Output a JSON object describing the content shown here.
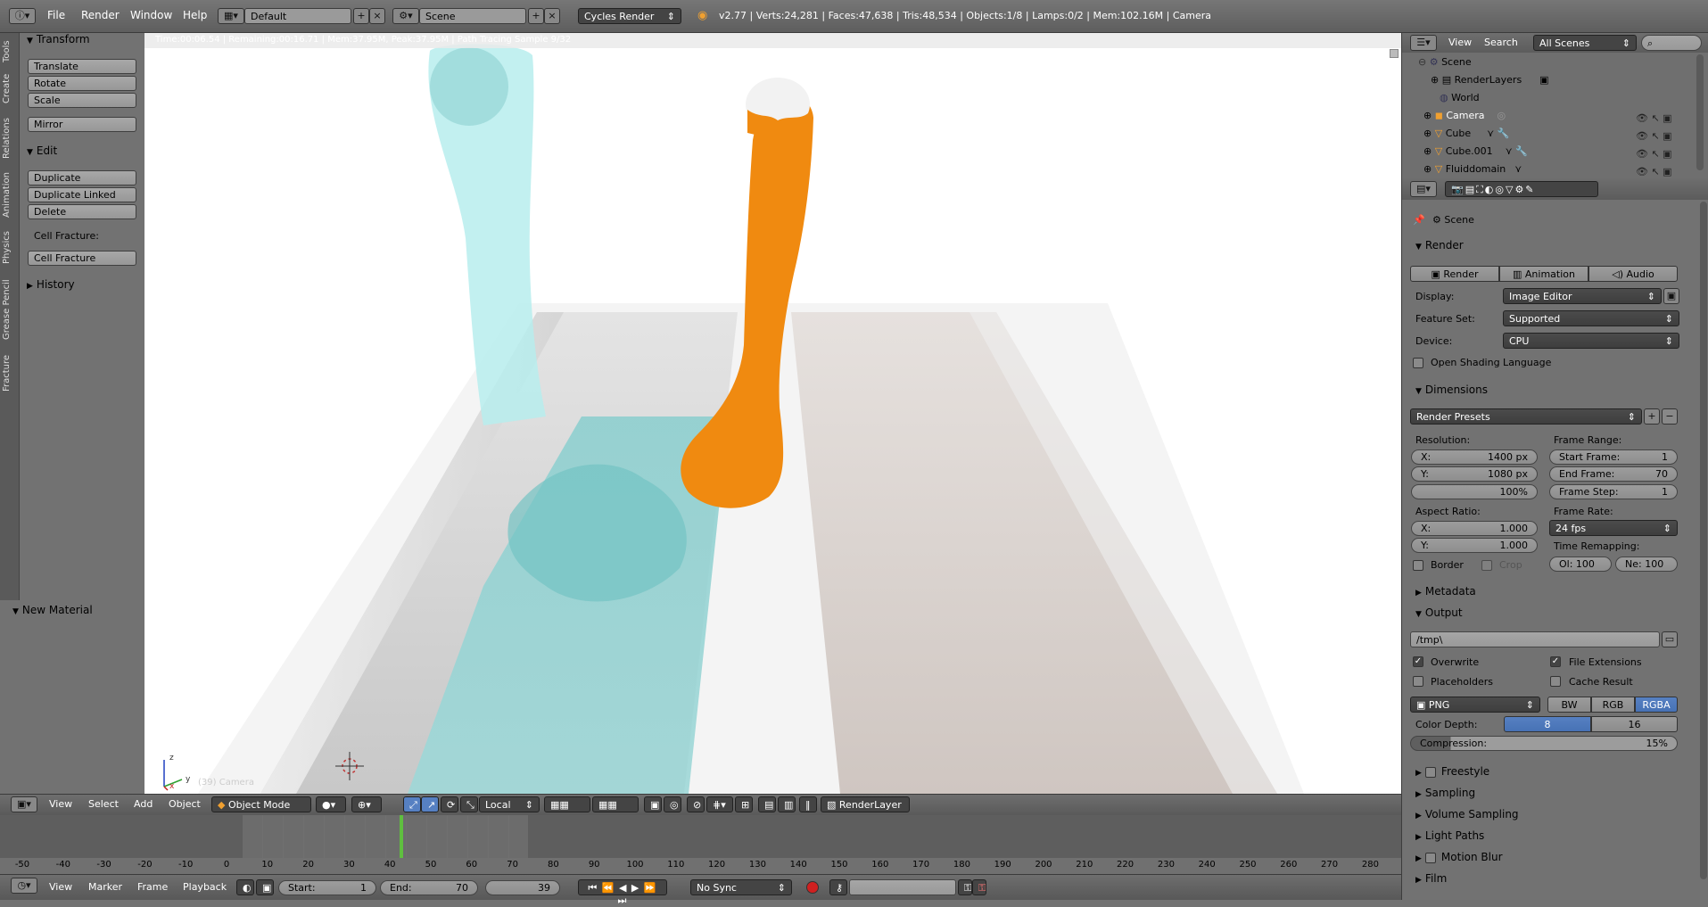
{
  "topbar": {
    "menus": [
      "File",
      "Render",
      "Window",
      "Help"
    ],
    "layout": "Default",
    "scene": "Scene",
    "engine": "Cycles Render",
    "stats": "v2.77 | Verts:24,281 | Faces:47,638 | Tris:48,534 | Objects:1/8 | Lamps:0/2 | Mem:102.16M | Camera"
  },
  "tool_tabs": [
    "Tools",
    "Create",
    "Relations",
    "Animation",
    "Physics",
    "Grease Pencil",
    "Fracture"
  ],
  "tools": {
    "transform_title": "Transform",
    "translate": "Translate",
    "rotate": "Rotate",
    "scale": "Scale",
    "mirror": "Mirror",
    "edit_title": "Edit",
    "duplicate": "Duplicate",
    "duplicate_linked": "Duplicate Linked",
    "delete": "Delete",
    "cell_fracture_label": "Cell Fracture:",
    "cell_fracture": "Cell Fracture",
    "history": "History",
    "new_material": "New Material"
  },
  "viewport": {
    "render_status": "Time:00:06.54 | Remaining:00:16.71 | Mem:37.95M, Peak:37.95M | Path Tracing Sample 9/32",
    "axis_x": "x",
    "axis_y": "y",
    "axis_z": "z",
    "corner_label": "(39) Camera"
  },
  "viewport_header": {
    "view": "View",
    "select": "Select",
    "add": "Add",
    "object": "Object",
    "mode": "Object Mode",
    "orientation": "Local",
    "render_layer": "RenderLayer"
  },
  "timeline": {
    "ticks": [
      "-50",
      "-40",
      "-30",
      "-20",
      "-10",
      "0",
      "10",
      "20",
      "30",
      "40",
      "50",
      "60",
      "70",
      "80",
      "90",
      "100",
      "110",
      "120",
      "130",
      "140",
      "150",
      "160",
      "170",
      "180",
      "190",
      "200",
      "210",
      "220",
      "230",
      "240",
      "250",
      "260",
      "270",
      "280"
    ],
    "view": "View",
    "marker": "Marker",
    "frame": "Frame",
    "playback": "Playback",
    "start_label": "Start:",
    "start_value": "1",
    "end_label": "End:",
    "end_value": "70",
    "current_frame": "39",
    "sync": "No Sync"
  },
  "outliner": {
    "view": "View",
    "search": "Search",
    "filter": "All Scenes",
    "items": [
      "Scene",
      "RenderLayers",
      "World",
      "Camera",
      "Cube",
      "Cube.001",
      "Fluiddomain"
    ]
  },
  "properties": {
    "scene": "Scene",
    "render_title": "Render",
    "render_btn": "Render",
    "animation_btn": "Animation",
    "audio_btn": "Audio",
    "display_label": "Display:",
    "display_value": "Image Editor",
    "featureset_label": "Feature Set:",
    "featureset_value": "Supported",
    "device_label": "Device:",
    "device_value": "CPU",
    "osl": "Open Shading Language",
    "dimensions_title": "Dimensions",
    "render_presets": "Render Presets",
    "resolution_label": "Resolution:",
    "res_x": "X:",
    "res_x_value": "1400 px",
    "res_y": "Y:",
    "res_y_value": "1080 px",
    "res_pct": "100%",
    "frame_range_label": "Frame Range:",
    "start_frame": "Start Frame:",
    "start_frame_value": "1",
    "end_frame": "End Frame:",
    "end_frame_value": "70",
    "frame_step": "Frame Step:",
    "frame_step_value": "1",
    "aspect_label": "Aspect Ratio:",
    "aspect_x": "X:",
    "aspect_x_value": "1.000",
    "aspect_y": "Y:",
    "aspect_y_value": "1.000",
    "frame_rate_label": "Frame Rate:",
    "frame_rate_value": "24 fps",
    "time_remap_label": "Time Remapping:",
    "old_label": "Ol:",
    "old_value": "100",
    "new_label": "Ne:",
    "new_value": "100",
    "border": "Border",
    "crop": "Crop",
    "metadata_title": "Metadata",
    "output_title": "Output",
    "output_path": "/tmp\\",
    "overwrite": "Overwrite",
    "file_extensions": "File Extensions",
    "placeholders": "Placeholders",
    "cache_result": "Cache Result",
    "format": "PNG",
    "bw": "BW",
    "rgb": "RGB",
    "rgba": "RGBA",
    "color_depth_label": "Color Depth:",
    "depth_8": "8",
    "depth_16": "16",
    "compression_label": "Compression:",
    "compression_value": "15%",
    "freestyle": "Freestyle",
    "sampling": "Sampling",
    "volume_sampling": "Volume Sampling",
    "light_paths": "Light Paths",
    "motion_blur": "Motion Blur",
    "film": "Film"
  },
  "colors": {
    "accent_blue": "#5680c2",
    "fluid_cyan": "#7fe0e0",
    "fluid_orange": "#f08a10",
    "timeline_cursor": "#5fbf3f"
  }
}
